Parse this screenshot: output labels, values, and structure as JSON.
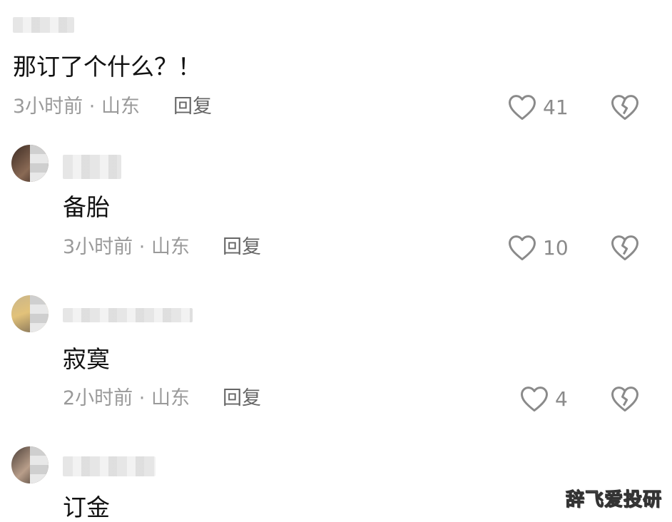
{
  "comments": [
    {
      "text": "那订了个什么？！",
      "time": "3小时前",
      "location": "山东",
      "reply_label": "回复",
      "likes": "41"
    },
    {
      "text": "备胎",
      "time": "3小时前",
      "location": "山东",
      "reply_label": "回复",
      "likes": "10"
    },
    {
      "text": "寂寞",
      "time": "2小时前",
      "location": "山东",
      "reply_label": "回复",
      "likes": "4"
    },
    {
      "text": "订金"
    }
  ],
  "meta_separator": "·",
  "icons": {
    "like": "heart-outline-icon",
    "dislike": "broken-heart-icon"
  },
  "watermark": "辞飞爱投研"
}
